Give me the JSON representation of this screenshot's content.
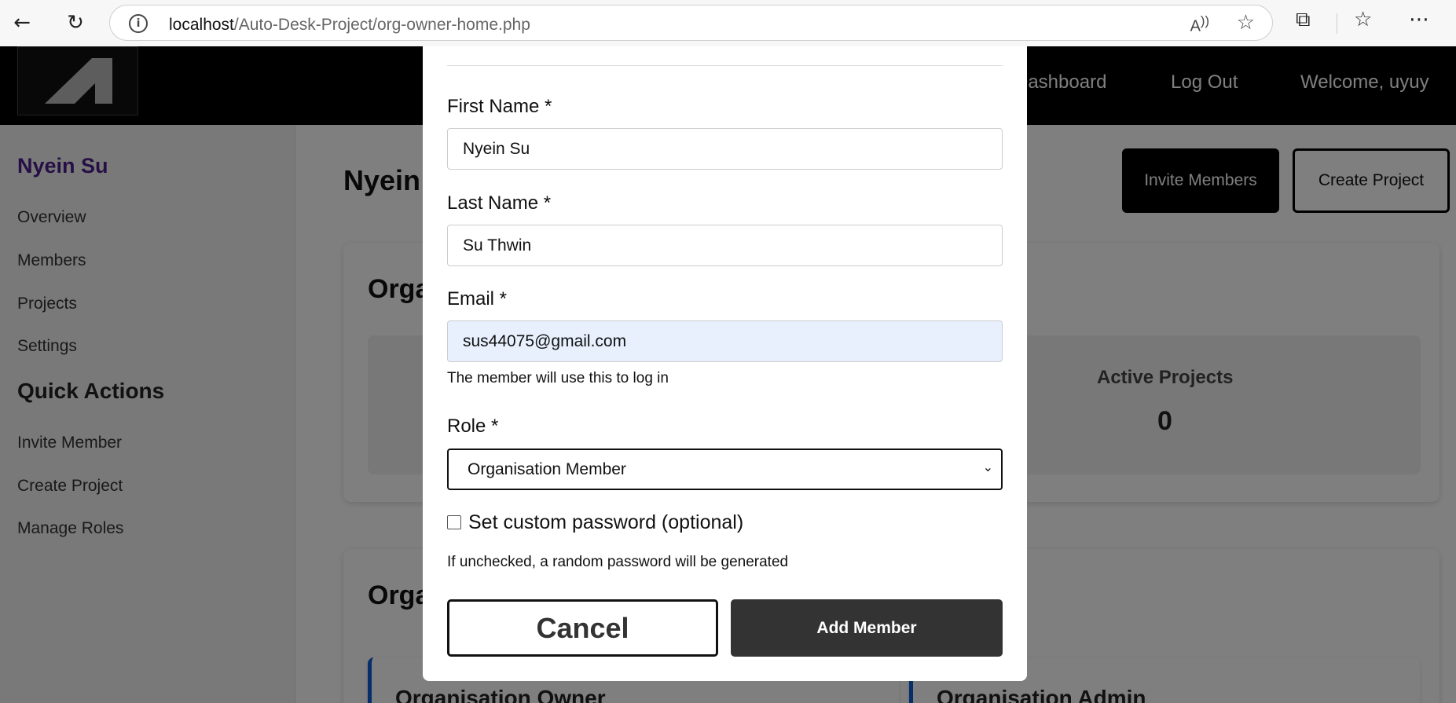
{
  "browser": {
    "url_host": "localhost",
    "url_path": "/Auto-Desk-Project/org-owner-home.php"
  },
  "topnav": {
    "dashboard": "Dashboard",
    "logout": "Log Out",
    "welcome": "Welcome, uyuy"
  },
  "sidebar": {
    "org_name": "Nyein Su",
    "items": [
      "Overview",
      "Members",
      "Projects",
      "Settings"
    ],
    "quick_actions_heading": "Quick Actions",
    "quick_actions": [
      "Invite Member",
      "Create Project",
      "Manage Roles"
    ]
  },
  "main": {
    "title": "Nyein",
    "invite_button": "Invite Members",
    "create_button": "Create Project",
    "overview_title": "Orga",
    "stat_label": "Active Projects",
    "stat_value": "0",
    "roles_title": "Orga",
    "role_owner": "Organisation Owner",
    "role_admin": "Organisation Admin"
  },
  "modal": {
    "first_name_label": "First Name *",
    "first_name_value": "Nyein Su",
    "last_name_label": "Last Name *",
    "last_name_value": "Su Thwin",
    "email_label": "Email *",
    "email_value": "sus44075@gmail.com",
    "email_help": "The member will use this to log in",
    "role_label": "Role *",
    "role_value": "Organisation Member",
    "custom_password_label": "Set custom password (optional)",
    "custom_password_checked": false,
    "password_help": "If unchecked, a random password will be generated",
    "cancel_button": "Cancel",
    "add_button": "Add Member"
  },
  "colors": {
    "brand_purple": "#4b1f8a",
    "role_accent": "#0b5cd6",
    "add_button_bg": "#333333"
  }
}
